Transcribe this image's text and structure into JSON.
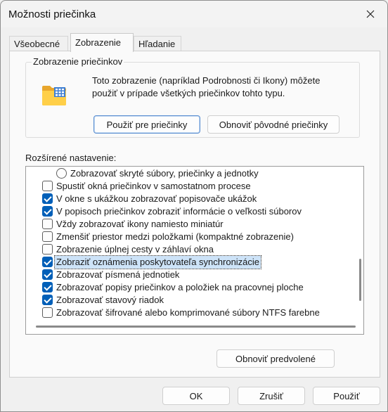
{
  "window": {
    "title": "Možnosti priečinka",
    "close_icon": "close-icon"
  },
  "tabs": [
    {
      "label": "Všeobecné",
      "active": false
    },
    {
      "label": "Zobrazenie",
      "active": true
    },
    {
      "label": "Hľadanie",
      "active": false
    }
  ],
  "folder_views": {
    "title": "Zobrazenie priečinkov",
    "icon": "folder-view-icon",
    "description": "Toto zobrazenie (napríklad Podrobnosti či Ikony) môžete použiť v prípade všetkých priečinkov tohto typu.",
    "apply_button": "Použiť pre priečinky",
    "reset_button": "Obnoviť pôvodné priečinky"
  },
  "advanced": {
    "label": "Rozšírené nastavenie:",
    "items": [
      {
        "type": "radio",
        "checked": false,
        "label": "Zobrazovať skryté súbory, priečinky a jednotky"
      },
      {
        "type": "checkbox",
        "checked": false,
        "label": "Spustiť okná priečinkov v samostatnom procese"
      },
      {
        "type": "checkbox",
        "checked": true,
        "label": "V okne s ukážkou zobrazovať popisovače ukážok"
      },
      {
        "type": "checkbox",
        "checked": true,
        "label": "V popisoch priečinkov zobraziť informácie o veľkosti súborov"
      },
      {
        "type": "checkbox",
        "checked": false,
        "label": "Vždy zobrazovať ikony namiesto miniatúr"
      },
      {
        "type": "checkbox",
        "checked": false,
        "label": "Zmenšiť priestor medzi položkami (kompaktné zobrazenie)"
      },
      {
        "type": "checkbox",
        "checked": false,
        "label": "Zobrazenie úplnej cesty v záhlaví okna"
      },
      {
        "type": "checkbox",
        "checked": true,
        "selected": true,
        "label": "Zobraziť oznámenia poskytovateľa synchronizácie"
      },
      {
        "type": "checkbox",
        "checked": true,
        "label": "Zobrazovať písmená jednotiek"
      },
      {
        "type": "checkbox",
        "checked": true,
        "label": "Zobrazovať popisy priečinkov a položiek na pracovnej ploche"
      },
      {
        "type": "checkbox",
        "checked": true,
        "label": "Zobrazovať stavový riadok"
      },
      {
        "type": "checkbox",
        "checked": false,
        "label": "Zobrazovať šifrované alebo komprimované súbory NTFS farebne"
      }
    ],
    "restore_button": "Obnoviť predvolené"
  },
  "footer": {
    "ok": "OK",
    "cancel": "Zrušiť",
    "apply": "Použiť"
  },
  "colors": {
    "accent": "#005fb8",
    "selection": "#cde3f8"
  }
}
